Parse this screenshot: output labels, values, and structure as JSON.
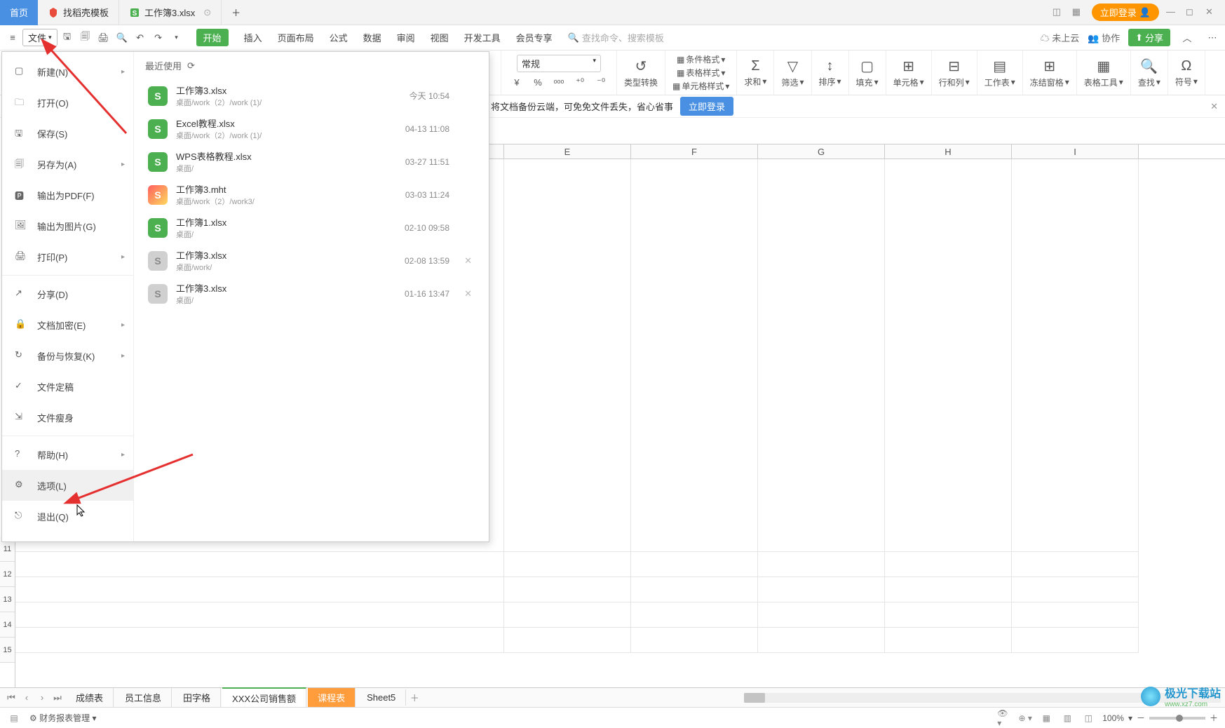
{
  "tabs": {
    "home": "首页",
    "template": "找稻壳模板",
    "doc": "工作簿3.xlsx"
  },
  "login_pill": "立即登录",
  "file_button": "文件",
  "menu": [
    "开始",
    "插入",
    "页面布局",
    "公式",
    "数据",
    "审阅",
    "视图",
    "开发工具",
    "会员专享"
  ],
  "search_placeholder": "查找命令、搜索模板",
  "toolbar_right": {
    "cloud": "未上云",
    "collab": "协作",
    "share": "分享"
  },
  "ribbon": {
    "numfmt": "常规",
    "type_convert": "类型转换",
    "cond_fmt": "条件格式",
    "table_style": "表格样式",
    "cell_style": "单元格样式",
    "sum": "求和",
    "filter": "筛选",
    "sort": "排序",
    "fill": "填充",
    "cell": "单元格",
    "rowcol": "行和列",
    "worksheet": "工作表",
    "freeze": "冻结窗格",
    "tabletool": "表格工具",
    "find": "查找",
    "symbol": "符号"
  },
  "banner": {
    "text": "将文档备份云端，可免免文件丢失，省心省事",
    "login": "立即登录"
  },
  "filemenu": {
    "items": [
      {
        "label": "新建(N)",
        "arrow": true
      },
      {
        "label": "打开(O)"
      },
      {
        "label": "保存(S)"
      },
      {
        "label": "另存为(A)",
        "arrow": true
      },
      {
        "label": "输出为PDF(F)"
      },
      {
        "label": "输出为图片(G)"
      },
      {
        "label": "打印(P)",
        "arrow": true
      }
    ],
    "items2": [
      {
        "label": "分享(D)"
      },
      {
        "label": "文档加密(E)",
        "arrow": true
      },
      {
        "label": "备份与恢复(K)",
        "arrow": true
      },
      {
        "label": "文件定稿"
      },
      {
        "label": "文件瘦身"
      }
    ],
    "items3": [
      {
        "label": "帮助(H)",
        "arrow": true
      },
      {
        "label": "选项(L)"
      },
      {
        "label": "退出(Q)"
      }
    ],
    "recent_header": "最近使用",
    "recent": [
      {
        "name": "工作簿3.xlsx",
        "path": "桌面/work（2）/work (1)/",
        "date": "今天  10:54",
        "c": "g"
      },
      {
        "name": "Excel教程.xlsx",
        "path": "桌面/work（2）/work (1)/",
        "date": "04-13 11:08",
        "c": "g"
      },
      {
        "name": "WPS表格教程.xlsx",
        "path": "桌面/",
        "date": "03-27 11:51",
        "c": "g"
      },
      {
        "name": "工作簿3.mht",
        "path": "桌面/work（2）/work3/",
        "date": "03-03 11:24",
        "c": "m"
      },
      {
        "name": "工作簿1.xlsx",
        "path": "桌面/",
        "date": "02-10 09:58",
        "c": "g"
      },
      {
        "name": "工作簿3.xlsx",
        "path": "桌面/work/",
        "date": "02-08 13:59",
        "c": "gr",
        "x": true
      },
      {
        "name": "工作簿3.xlsx",
        "path": "桌面/",
        "date": "01-16 13:47",
        "c": "gr",
        "x": true
      }
    ]
  },
  "cols": [
    "E",
    "F",
    "G",
    "H",
    "I"
  ],
  "rows": [
    "11",
    "12",
    "13",
    "14",
    "15"
  ],
  "sheets": [
    "成绩表",
    "员工信息",
    "田字格",
    "XXX公司销售额",
    "课程表",
    "Sheet5"
  ],
  "status": {
    "mgr": "财务报表管理",
    "zoom": "100%"
  },
  "watermark": {
    "brand": "极光下载站",
    "url": "www.xz7.com"
  }
}
